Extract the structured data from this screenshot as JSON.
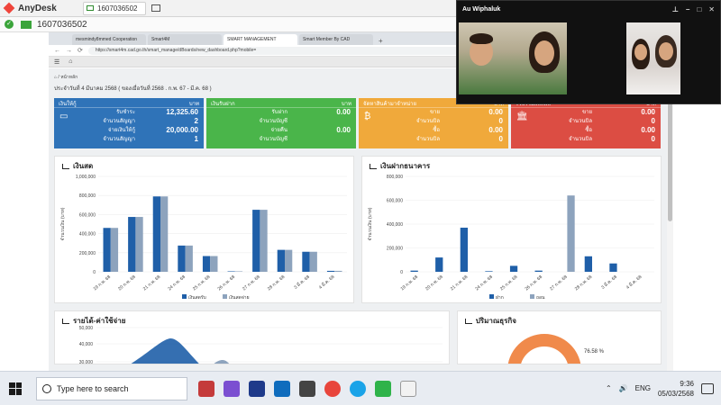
{
  "anydesk": {
    "brand": "AnyDesk",
    "tab_id": "1607036502",
    "address_id": "1607036502"
  },
  "browser": {
    "tabs": [
      {
        "label": "mesmindy8mmed Cooperation"
      },
      {
        "label": "Smart4M"
      },
      {
        "label": "SMART MANAGEMENT",
        "active": true
      },
      {
        "label": "Smart Member By CAD"
      }
    ],
    "url": "https://smart4m.cad.go.th/smart_manage/dBoards/new_dashboard.php?mobile="
  },
  "dashboard": {
    "breadcrumb": "⌂ / หน้าหลัก",
    "updated": "ประจำวันที่ 4 มีนาคม 2568 ( ของเมื่อวันที่ 2568 . ก.พ. 67 - มี.ค. 68 )",
    "cards": [
      {
        "title": "เงินให้กู้",
        "unit": "บาท",
        "color": "#2f73b8",
        "icon": "credit-card-icon",
        "rows": [
          {
            "label": "รับชำระ",
            "value": "12,325.60"
          },
          {
            "label": "จำนวนสัญญา",
            "value": "2"
          },
          {
            "label": "จ่ายเงินให้กู้",
            "value": "20,000.00"
          },
          {
            "label": "จำนวนสัญญา",
            "value": "1"
          }
        ]
      },
      {
        "title": "เงินรับฝาก",
        "unit": "บาท",
        "color": "#4ab54a",
        "icon": "deposit-icon",
        "rows": [
          {
            "label": "รับฝาก",
            "value": "0.00"
          },
          {
            "label": "จำนวนบัญชี",
            "value": ""
          },
          {
            "label": "จ่ายคืน",
            "value": "0.00"
          },
          {
            "label": "จำนวนบัญชี",
            "value": ""
          }
        ]
      },
      {
        "title": "จัดหาสินค้ามาจำหน่าย",
        "unit": "บาท",
        "color": "#f0a93b",
        "icon": "bitcoin-icon",
        "rows": [
          {
            "label": "ขาย",
            "value": "0.00"
          },
          {
            "label": "จำนวนบิล",
            "value": "0"
          },
          {
            "label": "ซื้อ",
            "value": "0.00"
          },
          {
            "label": "จำนวนบิล",
            "value": "0"
          }
        ]
      },
      {
        "title": "รวบรวมผลิตผล",
        "unit": "บาท",
        "color": "#dc4d43",
        "icon": "bank-icon",
        "rows": [
          {
            "label": "ขาย",
            "value": "0.00"
          },
          {
            "label": "จำนวนบิล",
            "value": "0"
          },
          {
            "label": "ซื้อ",
            "value": "0.00"
          },
          {
            "label": "จำนวนบิล",
            "value": "0"
          }
        ]
      }
    ],
    "panel_cash_title": "เงินสด",
    "panel_bank_title": "เงินฝากธนาคาร",
    "panel_income_title": "รายได้-ค่าใช้จ่าย",
    "panel_business_title": "ปริมาณธุรกิจ",
    "donut_label": "76.58 %"
  },
  "chart_data": [
    {
      "type": "bar",
      "title": "เงินสด",
      "ylabel": "จำนวนเงิน (บาท)",
      "ylim": [
        0,
        1000000
      ],
      "yticks": [
        "0",
        "200,000",
        "400,000",
        "600,000",
        "800,000",
        "1,000,000"
      ],
      "categories": [
        "19 ก.พ. 68",
        "20 ก.พ. 68",
        "21 ก.พ. 68",
        "24 ก.พ. 68",
        "25 ก.พ. 68",
        "26 ก.พ. 68",
        "27 ก.พ. 68",
        "28 ก.พ. 68",
        "3 มี.ค. 68",
        "4 มี.ค. 68"
      ],
      "series": [
        {
          "name": "เงินสดรับ",
          "color": "#1f5fa8",
          "values": [
            460000,
            575000,
            790000,
            275000,
            165000,
            5000,
            650000,
            230000,
            210000,
            10000
          ]
        },
        {
          "name": "เงินสดจ่าย",
          "color": "#8da3bd",
          "values": [
            460000,
            575000,
            790000,
            275000,
            165000,
            5000,
            650000,
            230000,
            210000,
            10000
          ]
        }
      ],
      "legend": "bottom"
    },
    {
      "type": "bar",
      "title": "เงินฝากธนาคาร",
      "ylabel": "จำนวนเงิน (บาท)",
      "ylim": [
        0,
        800000
      ],
      "yticks": [
        "0",
        "200,000",
        "400,000",
        "600,000",
        "800,000"
      ],
      "categories": [
        "19 ก.พ. 68",
        "20 ก.พ. 68",
        "21 ก.พ. 68",
        "24 ก.พ. 68",
        "25 ก.พ. 68",
        "26 ก.พ. 68",
        "27 ก.พ. 68",
        "28 ก.พ. 68",
        "3 มี.ค. 68",
        "4 มี.ค. 68"
      ],
      "series": [
        {
          "name": "ฝาก",
          "color": "#1f5fa8",
          "values": [
            10000,
            120000,
            370000,
            5000,
            50000,
            10000,
            0,
            130000,
            70000,
            0
          ]
        },
        {
          "name": "ถอน",
          "color": "#8da3bd",
          "values": [
            0,
            0,
            0,
            0,
            0,
            0,
            640000,
            0,
            0,
            0
          ]
        }
      ],
      "legend": "bottom"
    },
    {
      "type": "area",
      "title": "รายได้-ค่าใช้จ่าย",
      "ylim": [
        0,
        50000
      ],
      "yticks": [
        "30,000",
        "40,000",
        "50,000"
      ]
    }
  ],
  "call": {
    "title": "Au Wiphaluk"
  },
  "taskbar": {
    "search_placeholder": "Type here to search",
    "lang": "ENG",
    "time": "9:36",
    "date": "05/03/2568"
  }
}
